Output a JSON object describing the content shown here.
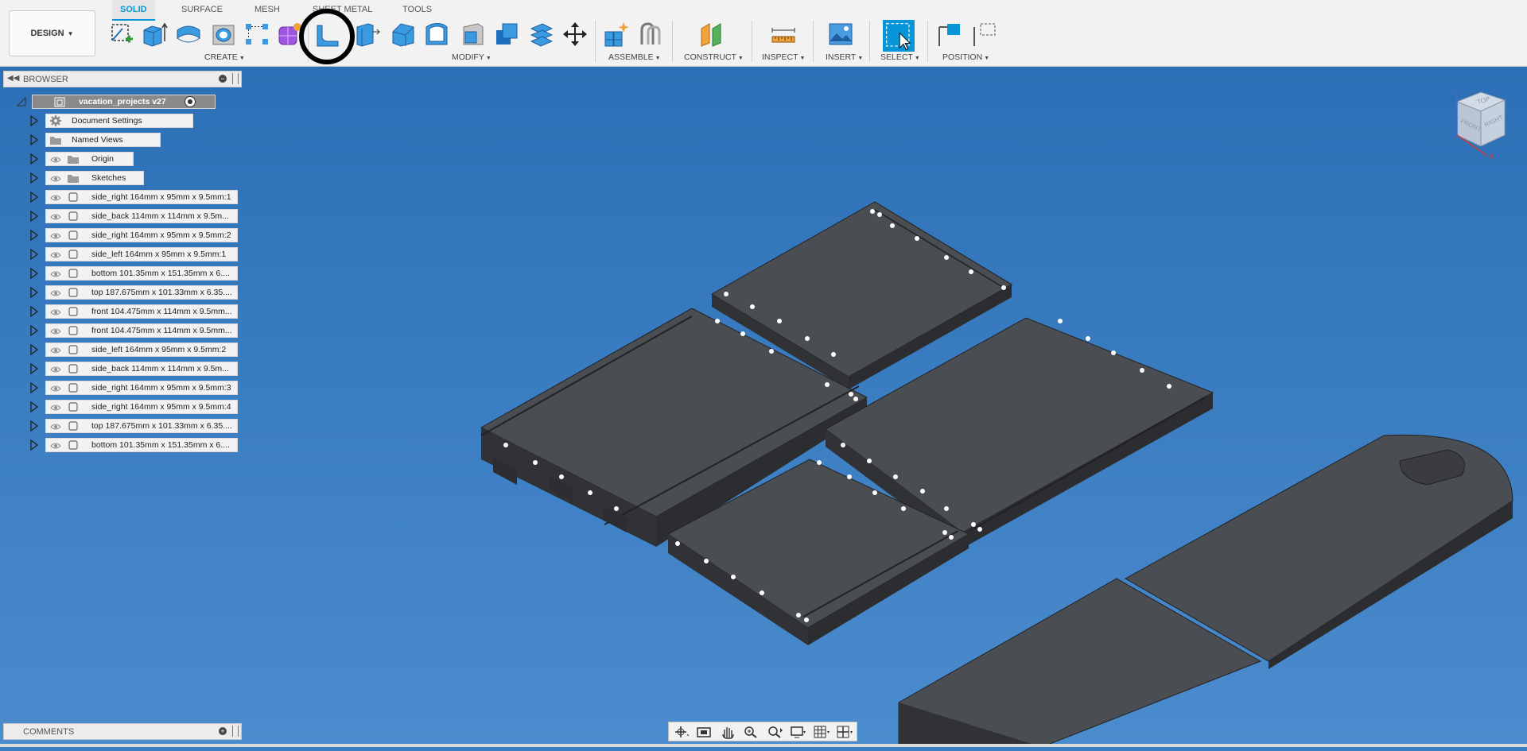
{
  "app": {
    "workspace": "DESIGN",
    "colors": {
      "accent": "#0696d7",
      "viewport_bg": "#3a7fc4",
      "panel_bg": "#f2f2f2",
      "body_dark": "#4a4d52"
    }
  },
  "tabs": [
    {
      "label": "SOLID",
      "active": true
    },
    {
      "label": "SURFACE",
      "active": false
    },
    {
      "label": "MESH",
      "active": false
    },
    {
      "label": "SHEET METAL",
      "active": false
    },
    {
      "label": "TOOLS",
      "active": false
    }
  ],
  "toolbar": {
    "groups": {
      "create": "CREATE",
      "modify": "MODIFY",
      "assemble": "ASSEMBLE",
      "construct": "CONSTRUCT",
      "inspect": "INSPECT",
      "insert": "INSERT",
      "select": "SELECT",
      "position": "POSITION"
    },
    "tools": [
      "create-sketch-icon",
      "extrude-icon",
      "revolve-icon",
      "hole-icon",
      "rectangular-pattern-icon",
      "create-form-icon",
      "fillet-icon",
      "press-pull-icon",
      "chamfer-icon",
      "shell-icon",
      "draft-icon",
      "combine-icon",
      "offset-face-icon",
      "move-copy-icon",
      "new-component-icon",
      "joint-icon",
      "offset-plane-icon",
      "measure-icon",
      "insert-image-icon",
      "select-icon",
      "capture-position-icon",
      "revert-position-icon"
    ]
  },
  "browser": {
    "title": "BROWSER",
    "root": "vacation_projects v27",
    "items": [
      {
        "label": "Document Settings",
        "icon": "gear-icon",
        "eye": false
      },
      {
        "label": "Named Views",
        "icon": "folder-icon",
        "eye": false
      },
      {
        "label": "Origin",
        "icon": "folder-icon",
        "eye": true
      },
      {
        "label": "Sketches",
        "icon": "folder-icon",
        "eye": true
      },
      {
        "label": "side_right 164mm x 95mm x 9.5mm:1",
        "icon": "body-icon",
        "eye": true
      },
      {
        "label": "side_back 114mm x 114mm x 9.5m...",
        "icon": "body-icon",
        "eye": true
      },
      {
        "label": "side_right 164mm x 95mm x 9.5mm:2",
        "icon": "body-icon",
        "eye": true
      },
      {
        "label": "side_left 164mm x 95mm x 9.5mm:1",
        "icon": "body-icon",
        "eye": true
      },
      {
        "label": "bottom 101.35mm x 151.35mm x 6....",
        "icon": "body-icon",
        "eye": true
      },
      {
        "label": "top 187.675mm x 101.33mm x 6.35....",
        "icon": "body-icon",
        "eye": true
      },
      {
        "label": "front 104.475mm x 114mm x 9.5mm...",
        "icon": "body-icon",
        "eye": true
      },
      {
        "label": "front 104.475mm x 114mm x 9.5mm...",
        "icon": "body-icon",
        "eye": true
      },
      {
        "label": "side_left 164mm x 95mm x 9.5mm:2",
        "icon": "body-icon",
        "eye": true
      },
      {
        "label": "side_back 114mm x 114mm x 9.5m...",
        "icon": "body-icon",
        "eye": true
      },
      {
        "label": "side_right 164mm x 95mm x 9.5mm:3",
        "icon": "body-icon",
        "eye": true
      },
      {
        "label": "side_right 164mm x 95mm x 9.5mm:4",
        "icon": "body-icon",
        "eye": true
      },
      {
        "label": "top 187.675mm x 101.33mm x 6.35....",
        "icon": "body-icon",
        "eye": true
      },
      {
        "label": "bottom 101.35mm x 151.35mm x 6....",
        "icon": "body-icon",
        "eye": true
      }
    ]
  },
  "comments": {
    "title": "COMMENTS"
  },
  "viewcube": {
    "top": "TOP",
    "front": "FRONT",
    "right": "RIGHT",
    "axis_z": "Z",
    "axis_x": "X"
  },
  "navbar": {
    "tools": [
      "orbit-icon",
      "look-at-icon",
      "pan-icon",
      "zoom-icon",
      "fit-icon",
      "display-settings-icon",
      "grid-icon",
      "viewports-icon"
    ]
  }
}
